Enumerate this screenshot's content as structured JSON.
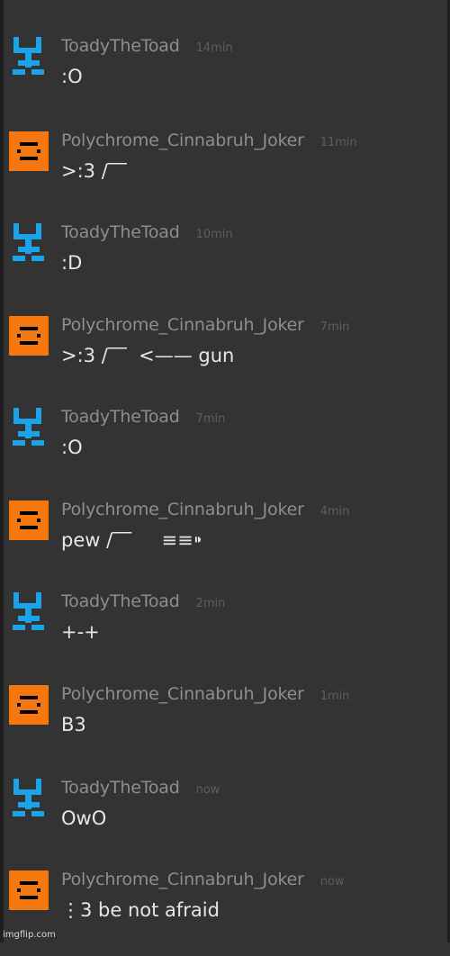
{
  "colors": {
    "background": "#333333",
    "toad_avatar": "#1aa3e8",
    "joker_avatar": "#f7770f",
    "username": "#8e8e8e",
    "timestamp": "#5e5e5e",
    "message_text": "#e6e6e6"
  },
  "messages": [
    {
      "user": "ToadyTheToad",
      "avatar": "toad-avatar-icon",
      "time": "14min",
      "text": ":O"
    },
    {
      "user": "Polychrome_Cinnabruh_Joker",
      "avatar": "joker-avatar-icon",
      "time": "11min",
      "text": ">:3 /‾‾"
    },
    {
      "user": "ToadyTheToad",
      "avatar": "toad-avatar-icon",
      "time": "10min",
      "text": ":D"
    },
    {
      "user": "Polychrome_Cinnabruh_Joker",
      "avatar": "joker-avatar-icon",
      "time": "7min",
      "text": ">:3 /‾‾  <—— gun"
    },
    {
      "user": "ToadyTheToad",
      "avatar": "toad-avatar-icon",
      "time": "7min",
      "text": ":O"
    },
    {
      "user": "Polychrome_Cinnabruh_Joker",
      "avatar": "joker-avatar-icon",
      "time": "4min",
      "text": "pew /‾‾     ≡≡⁍"
    },
    {
      "user": "ToadyTheToad",
      "avatar": "toad-avatar-icon",
      "time": "2min",
      "text": "+-+"
    },
    {
      "user": "Polychrome_Cinnabruh_Joker",
      "avatar": "joker-avatar-icon",
      "time": "1min",
      "text": "B3"
    },
    {
      "user": "ToadyTheToad",
      "avatar": "toad-avatar-icon",
      "time": "now",
      "text": "OwO"
    },
    {
      "user": "Polychrome_Cinnabruh_Joker",
      "avatar": "joker-avatar-icon",
      "time": "now",
      "text": "⋮3 be not afraid"
    }
  ],
  "watermark": "imgflip.com"
}
